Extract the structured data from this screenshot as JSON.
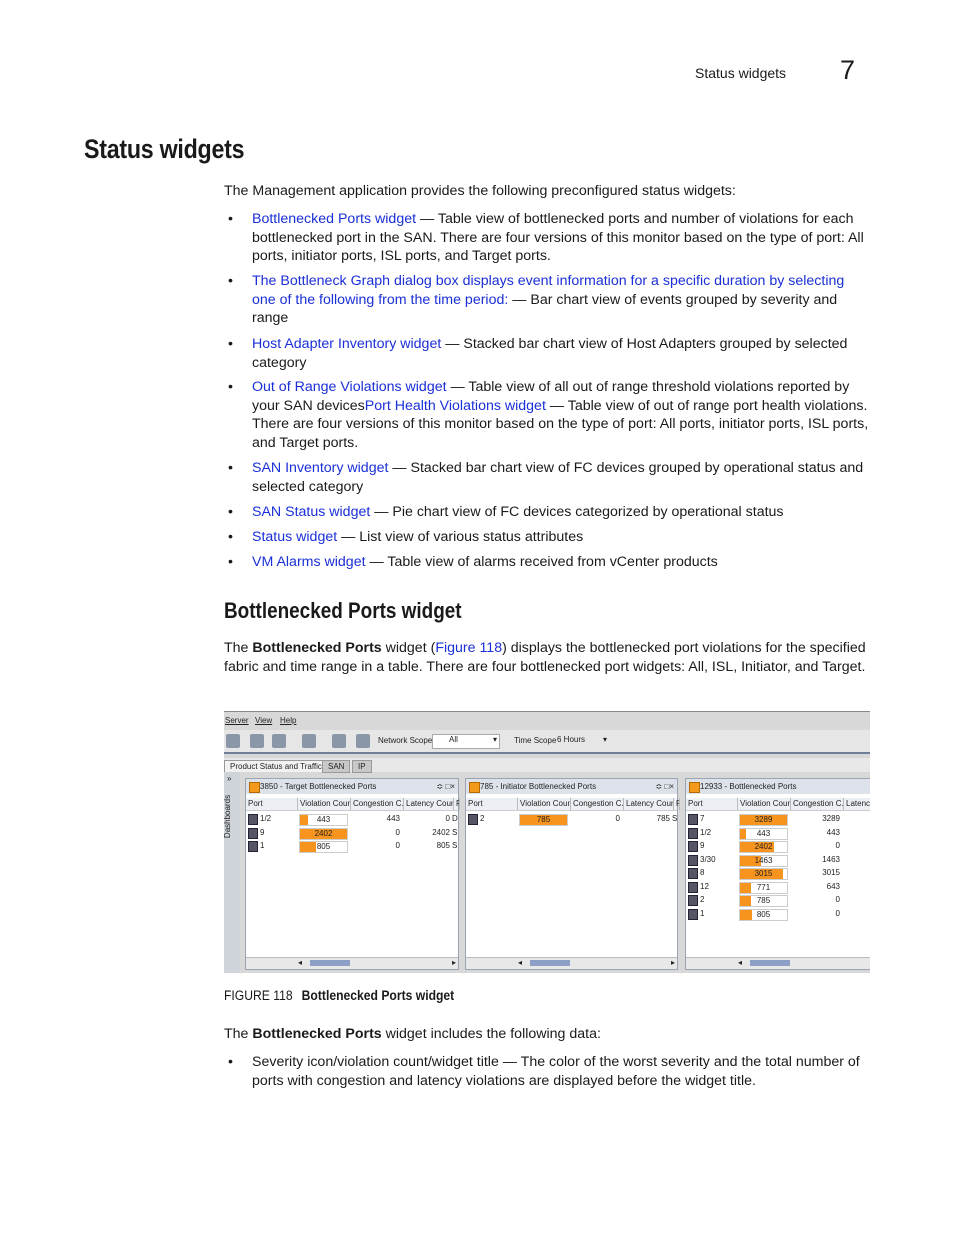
{
  "header": {
    "section": "Status widgets",
    "chapter": "7"
  },
  "title": "Status widgets",
  "intro": "The Management application provides the following preconfigured status widgets:",
  "bullets": [
    {
      "link": "Bottlenecked Ports widget",
      "text": " — Table view of bottlenecked ports and number of violations for each bottlenecked port in the SAN. There are four versions of this monitor based on the type of port: All ports, initiator ports, ISL ports, and Target ports."
    },
    {
      "link": "The Bottleneck Graph dialog box displays event information for a specific duration by selecting one of the following from the time period:",
      "text": " — Bar chart view of events grouped by severity and range"
    },
    {
      "link": "Host Adapter Inventory widget",
      "text": " — Stacked bar chart view of Host Adapters grouped by selected category"
    },
    {
      "link": "Out of Range Violations widget",
      "text": " — Table view of all out of range threshold violations reported by your SAN devices",
      "link2": "Port Health Violations widget",
      "text2": " — Table view of out of range port health violations. There are four versions of this monitor based on the type of port: All ports, initiator ports, ISL ports, and Target ports."
    },
    {
      "link": "SAN Inventory widget",
      "text": " — Stacked bar chart view of FC devices grouped by operational status and selected category"
    },
    {
      "link": "SAN Status widget",
      "text": " — Pie chart view of FC devices categorized by operational status"
    },
    {
      "link": "Status widget",
      "text": " — List view of various status attributes"
    },
    {
      "link": "VM Alarms widget",
      "text": " — Table view of alarms received from vCenter products"
    }
  ],
  "section2": {
    "title": "Bottlenecked Ports widget",
    "p1": {
      "a": "The ",
      "b": "Bottlenecked Ports",
      "c": " widget (",
      "link": "Figure 118",
      "d": ") displays the bottlenecked port violations for the specified fabric and time range in a table. There are four bottlenecked port widgets: All, ISL, Initiator, and Target."
    },
    "p2": {
      "a": "The ",
      "b": "Bottlenecked Ports",
      "c": " widget includes the following data:"
    },
    "bullets": [
      "Severity icon/violation count/widget title — The color of the worst severity and the total number of ports with congestion and latency violations are displayed before the widget title."
    ]
  },
  "figure": {
    "caption_label": "FIGURE 118",
    "caption": "Bottlenecked Ports widget",
    "menu": [
      "Server",
      "View",
      "Help"
    ],
    "network_scope_label": "Network Scope",
    "network_scope_value": "All",
    "time_scope_label": "Time Scope",
    "time_scope_value": "6 Hours",
    "tabs": [
      "Product Status and Traffic",
      "SAN",
      "IP"
    ],
    "sidebar_label": "Dashboards",
    "sidebar_chevron": "»",
    "severity_color": "#f7941d",
    "panels": [
      {
        "title": "3850 - Target Bottlenecked Ports",
        "columns": [
          "Port",
          "Violation Count",
          "Congestion C...",
          "Latency Count",
          "P"
        ],
        "rows": [
          [
            "1/2",
            "443",
            "443",
            "0",
            "D"
          ],
          [
            "9",
            "2402",
            "0",
            "2402",
            "S"
          ],
          [
            "1",
            "805",
            "0",
            "805",
            "S"
          ]
        ],
        "fills": [
          0.18,
          1.0,
          0.34
        ]
      },
      {
        "title": "785 - Initiator Bottlenecked Ports",
        "columns": [
          "Port",
          "Violation Count",
          "Congestion C...",
          "Latency Count",
          "P"
        ],
        "rows": [
          [
            "2",
            "785",
            "0",
            "785",
            "S"
          ]
        ],
        "fills": [
          1.0
        ]
      },
      {
        "title": "12933 - Bottlenecked Ports",
        "columns": [
          "Port",
          "Violation Count",
          "Congestion C...",
          "Latency C"
        ],
        "rows": [
          [
            "7",
            "3289",
            "3289"
          ],
          [
            "1/2",
            "443",
            "443"
          ],
          [
            "9",
            "2402",
            "0"
          ],
          [
            "3/30",
            "1463",
            "1463"
          ],
          [
            "8",
            "3015",
            "3015"
          ],
          [
            "12",
            "771",
            "643"
          ],
          [
            "2",
            "785",
            "0"
          ],
          [
            "1",
            "805",
            "0"
          ]
        ],
        "fills": [
          1.0,
          0.13,
          0.73,
          0.44,
          0.92,
          0.23,
          0.24,
          0.25
        ]
      }
    ]
  }
}
